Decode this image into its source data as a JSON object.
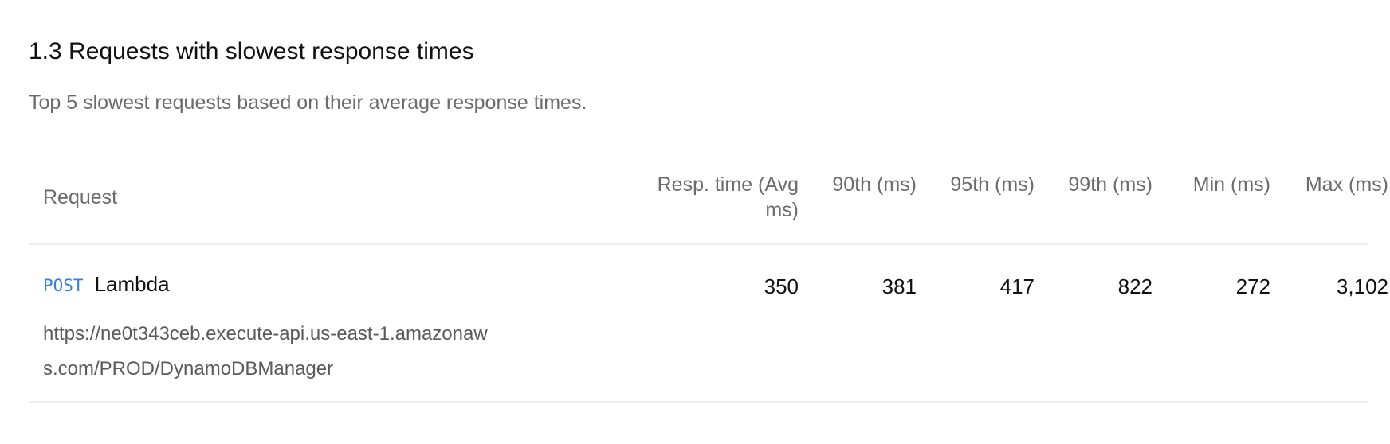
{
  "section": {
    "title": "1.3 Requests with slowest response times",
    "description": "Top 5 slowest requests based on their average response times."
  },
  "table": {
    "headers": {
      "request": "Request",
      "avg": "Resp. time (Avg ms)",
      "p90": "90th (ms)",
      "p95": "95th (ms)",
      "p99": "99th (ms)",
      "min": "Min (ms)",
      "max": "Max (ms)"
    },
    "rows": [
      {
        "method": "POST",
        "name": "Lambda",
        "url": "https://ne0t343ceb.execute-api.us-east-1.amazonaws.com/PROD/DynamoDBManager",
        "avg": "350",
        "p90": "381",
        "p95": "417",
        "p99": "822",
        "min": "272",
        "max": "3,102"
      }
    ]
  },
  "colors": {
    "method": "#3b7ddd",
    "muted_text": "#6b6b6b",
    "divider": "#ececec"
  }
}
